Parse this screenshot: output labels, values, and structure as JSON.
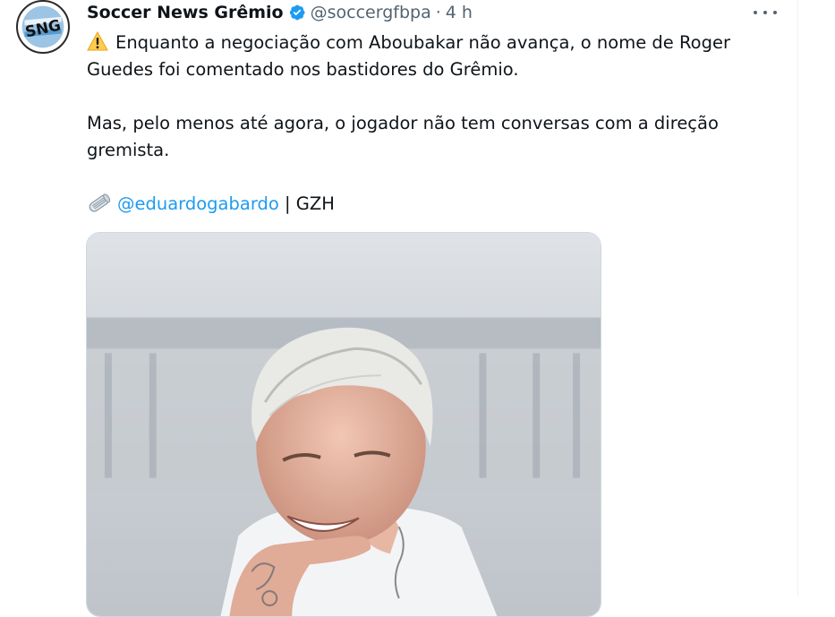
{
  "tweet": {
    "author": {
      "display_name": "Soccer News Grêmio",
      "handle": "@soccergfbpa",
      "avatar_text": "SNG",
      "verified": true
    },
    "separator": "·",
    "time": "4 h",
    "text": {
      "line1": "Enquanto a negociação com Aboubakar não avança, o nome de Roger Guedes foi comentado nos bastidores do Grêmio.",
      "line2": "Mas, pelo menos até agora, o jogador não tem conversas com a direção gremista.",
      "mention": "@eduardogabardo",
      "source_suffix": " | GZH"
    },
    "icons": {
      "warning": "warning-icon",
      "newspaper": "rolled-newspaper-icon",
      "verified": "verified-badge-icon",
      "more": "more-options-icon"
    },
    "colors": {
      "accent": "#1d9bf0",
      "secondary_text": "#536471",
      "primary_text": "#0f1419"
    }
  }
}
